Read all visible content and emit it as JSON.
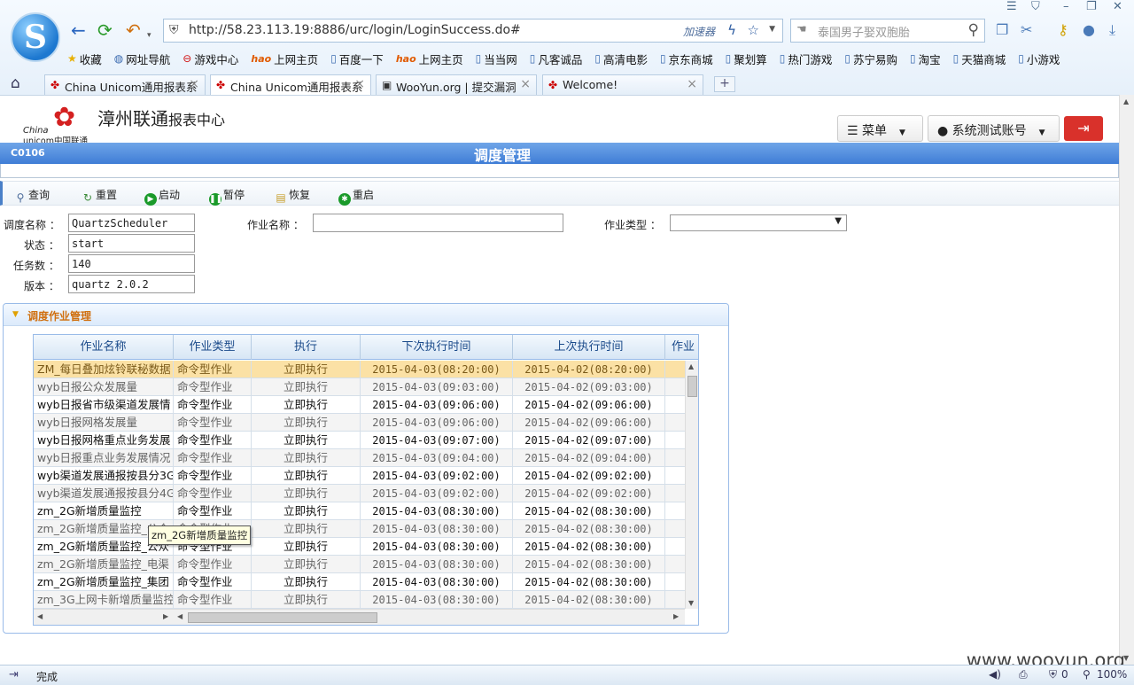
{
  "browser": {
    "logo_letter": "S",
    "url": "http://58.23.113.19:8886/urc/login/LoginSuccess.do#",
    "accelerator": "加速器",
    "search_placeholder": "泰国男子娶双胞胎",
    "bookmarks": [
      "收藏",
      "网址导航",
      "游戏中心",
      "上网主页",
      "百度一下",
      "上网主页",
      "当当网",
      "凡客诚品",
      "高清电影",
      "京东商城",
      "聚划算",
      "热门游戏",
      "苏宁易购",
      "淘宝",
      "天猫商城",
      "小游戏"
    ],
    "tabs": [
      "China Unicom通用报表系",
      "China Unicom通用报表系",
      "WooYun.org | 提交漏洞",
      "Welcome!"
    ],
    "active_tab": 1
  },
  "header": {
    "brand_main": "漳州联通",
    "brand_sub": "报表中心",
    "logo_china": "China",
    "logo_unicom": "unicom中国联通",
    "menu_label": "菜单",
    "account_label": "系统测试账号"
  },
  "titlebar": {
    "code": "C0106",
    "title": "调度管理"
  },
  "toolbar": [
    {
      "label": "查询",
      "icon": "search-icon",
      "color": "#5a7fb0"
    },
    {
      "label": "重置",
      "icon": "refresh-icon",
      "color": "#3a8a3a"
    },
    {
      "label": "启动",
      "icon": "play-icon",
      "color": "#1a9a2a"
    },
    {
      "label": "暂停",
      "icon": "pause-icon",
      "color": "#1a9a2a"
    },
    {
      "label": "恢复",
      "icon": "restore-icon",
      "color": "#c8a030"
    },
    {
      "label": "重启",
      "icon": "restart-icon",
      "color": "#1a9a2a"
    }
  ],
  "form": {
    "scheduler_name_label": "调度名称 ：",
    "scheduler_name": "QuartzScheduler",
    "status_label": "状态 ：",
    "status": "start",
    "task_count_label": "任务数 ：",
    "task_count": "140",
    "version_label": "版本 ：",
    "version": "quartz 2.0.2",
    "job_name_label": "作业名称 ：",
    "job_name": "",
    "job_type_label": "作业类型 ：",
    "job_type": ""
  },
  "panel": {
    "title": "调度作业管理"
  },
  "grid": {
    "columns": [
      "作业名称",
      "作业类型",
      "执行",
      "下次执行时间",
      "上次执行时间",
      "作业"
    ],
    "rows": [
      [
        "ZM_每日叠加炫铃联秘数据",
        "命令型作业",
        "立即执行",
        "2015-04-03(08:20:00)",
        "2015-04-02(08:20:00)"
      ],
      [
        "wyb日报公众发展量",
        "命令型作业",
        "立即执行",
        "2015-04-03(09:03:00)",
        "2015-04-02(09:03:00)"
      ],
      [
        "wyb日报省市级渠道发展情",
        "命令型作业",
        "立即执行",
        "2015-04-03(09:06:00)",
        "2015-04-02(09:06:00)"
      ],
      [
        "wyb日报网格发展量",
        "命令型作业",
        "立即执行",
        "2015-04-03(09:06:00)",
        "2015-04-02(09:06:00)"
      ],
      [
        "wyb日报网格重点业务发展",
        "命令型作业",
        "立即执行",
        "2015-04-03(09:07:00)",
        "2015-04-02(09:07:00)"
      ],
      [
        "wyb日报重点业务发展情况",
        "命令型作业",
        "立即执行",
        "2015-04-03(09:04:00)",
        "2015-04-02(09:04:00)"
      ],
      [
        "wyb渠道发展通报按县分3G",
        "命令型作业",
        "立即执行",
        "2015-04-03(09:02:00)",
        "2015-04-02(09:02:00)"
      ],
      [
        "wyb渠道发展通报按县分4G",
        "命令型作业",
        "立即执行",
        "2015-04-03(09:02:00)",
        "2015-04-02(09:02:00)"
      ],
      [
        "zm_2G新增质量监控",
        "命令型作业",
        "立即执行",
        "2015-04-03(08:30:00)",
        "2015-04-02(08:30:00)"
      ],
      [
        "zm_2G新增质量监控_公众",
        "命令型作业",
        "立即执行",
        "2015-04-03(08:30:00)",
        "2015-04-02(08:30:00)"
      ],
      [
        "zm_2G新增质量监控_公众",
        "命令型作业",
        "立即执行",
        "2015-04-03(08:30:00)",
        "2015-04-02(08:30:00)"
      ],
      [
        "zm_2G新增质量监控_电渠",
        "命令型作业",
        "立即执行",
        "2015-04-03(08:30:00)",
        "2015-04-02(08:30:00)"
      ],
      [
        "zm_2G新增质量监控_集团",
        "命令型作业",
        "立即执行",
        "2015-04-03(08:30:00)",
        "2015-04-02(08:30:00)"
      ],
      [
        "zm_3G上网卡新增质量监控",
        "命令型作业",
        "立即执行",
        "2015-04-03(08:30:00)",
        "2015-04-02(08:30:00)"
      ]
    ],
    "selected_row": 0,
    "tooltip": "zm_2G新增质量监控"
  },
  "status": {
    "text": "完成",
    "zoom": "100%",
    "count": "0"
  },
  "watermark": "www.wooyun.org"
}
